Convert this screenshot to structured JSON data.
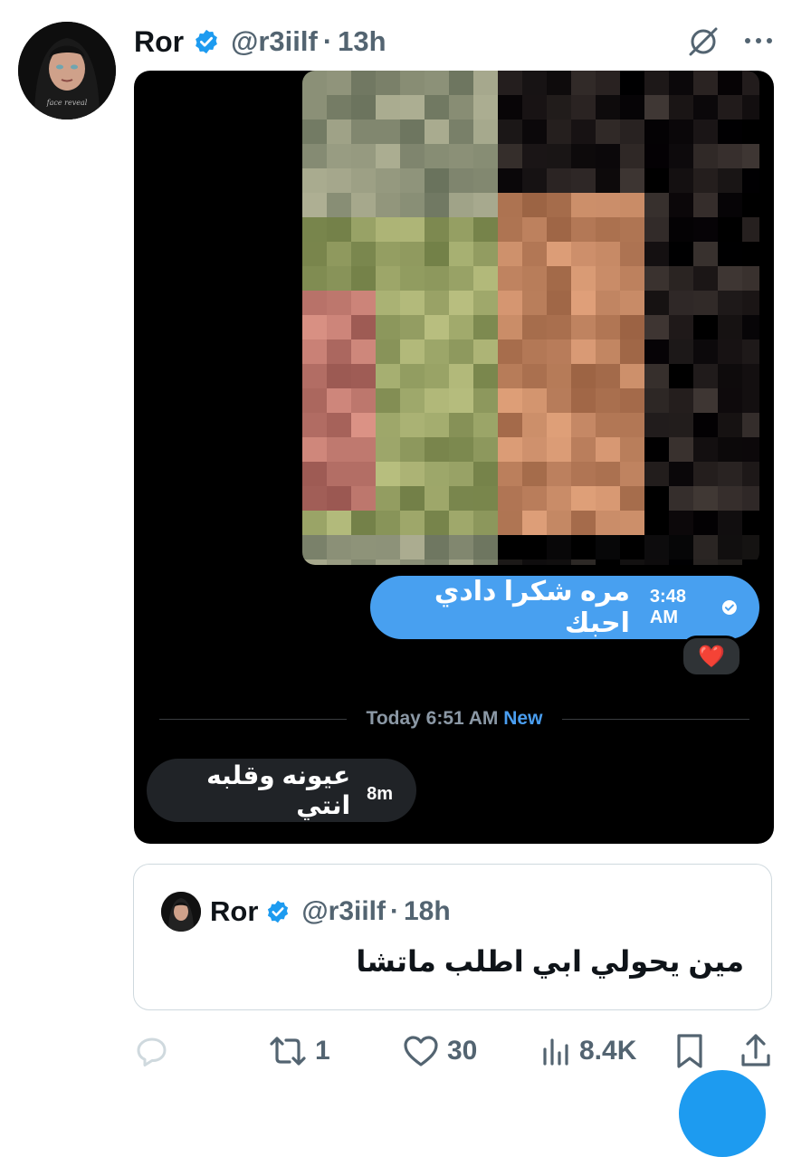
{
  "tweet": {
    "display_name": "Ror",
    "handle": "@r3iilf",
    "separator": "·",
    "time": "13h",
    "avatar_caption": "face reveal"
  },
  "media": {
    "outgoing_message": {
      "text": "مره شكرا دادي احبك",
      "time": "3:48 AM",
      "reaction": "❤️"
    },
    "divider": {
      "label": "Today 6:51 AM",
      "badge": "New"
    },
    "incoming_message": {
      "text": "عيونه وقلبه انتي",
      "time": "8m"
    }
  },
  "quote": {
    "display_name": "Ror",
    "handle": "@r3iilf",
    "separator": "·",
    "time": "18h",
    "text": "مين يحولي ابي اطلب ماتشا"
  },
  "actions": {
    "reply_count": "",
    "retweet_count": "1",
    "like_count": "30",
    "views_count": "8.4K"
  },
  "colors": {
    "verified": "#1d9bf0",
    "bubble_outgoing": "#48a0f0",
    "bubble_incoming": "#202327",
    "new_badge": "#4a9ef0",
    "heart": "#e0245e"
  }
}
